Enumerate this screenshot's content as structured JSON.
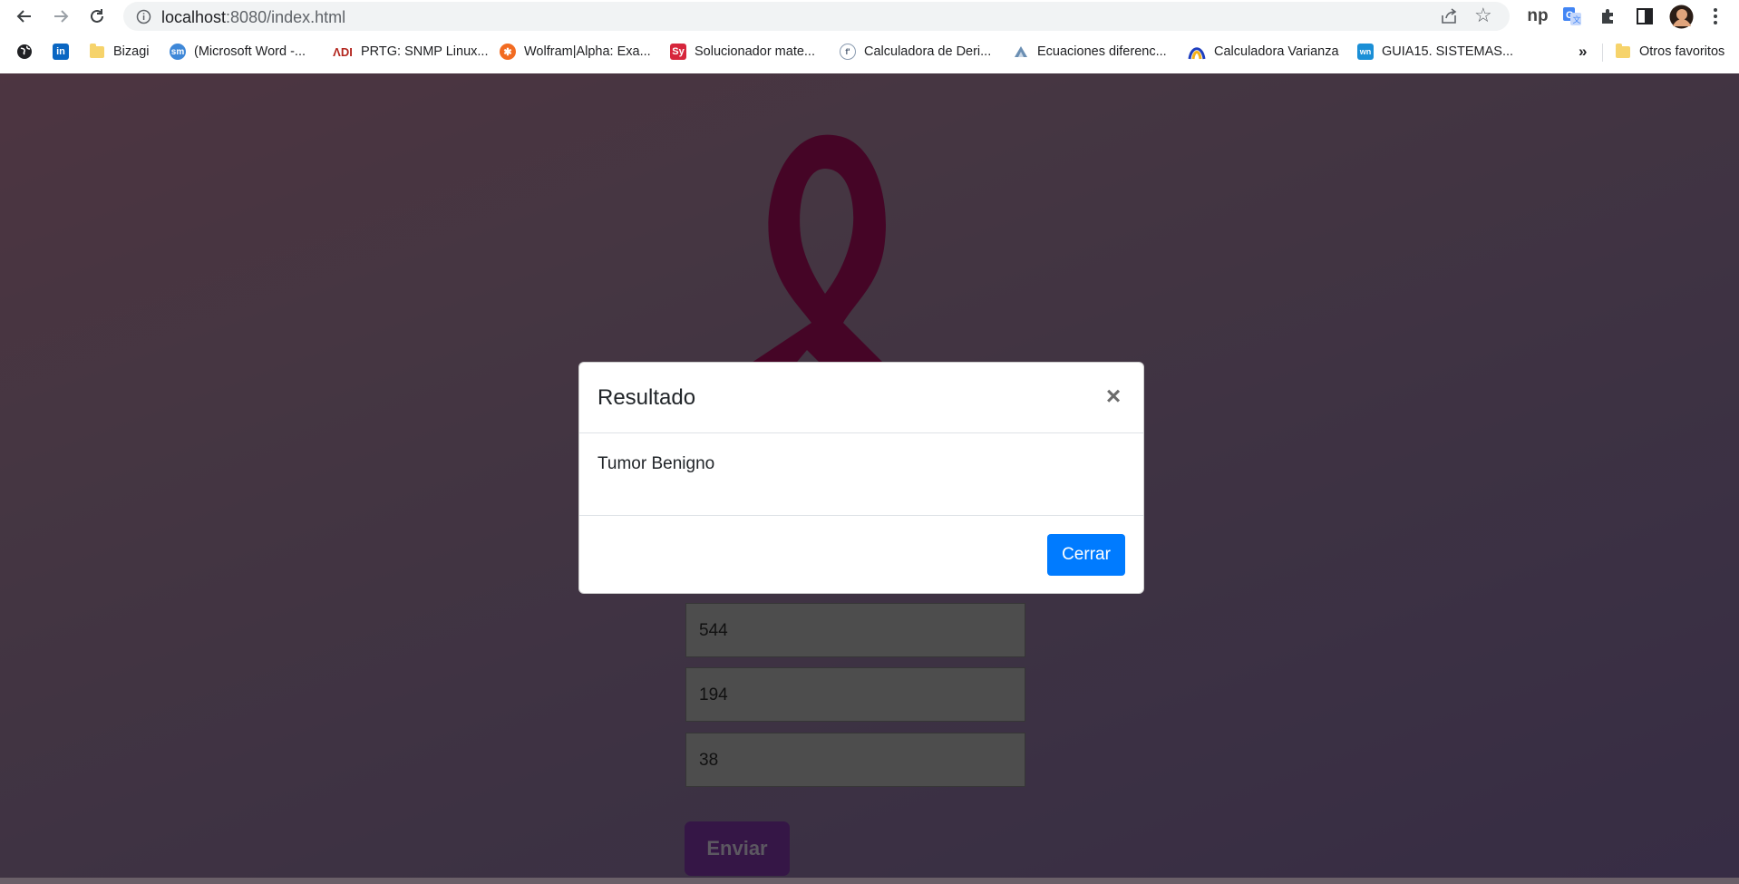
{
  "browser": {
    "url_host": "localhost",
    "url_rest": ":8080/index.html"
  },
  "bookmarks": [
    {
      "label": "Bizagi",
      "icon": "folder-icon"
    },
    {
      "label": "(Microsoft Word -...",
      "icon": "sm-icon"
    },
    {
      "label": "PRTG: SNMP Linux...",
      "icon": "prtg-icon"
    },
    {
      "label": "Wolfram|Alpha: Exa...",
      "icon": "wolfram-icon"
    },
    {
      "label": "Solucionador mate...",
      "icon": "sy-icon"
    },
    {
      "label": "Calculadora de Deri...",
      "icon": "derivative-icon"
    },
    {
      "label": "Ecuaciones diferenc...",
      "icon": "triangle-icon"
    },
    {
      "label": "Calculadora Varianza",
      "icon": "varianza-icon"
    },
    {
      "label": "GUIA15. SISTEMAS...",
      "icon": "wn-icon"
    }
  ],
  "overflow_label": "»",
  "other_bookmarks": "Otros favoritos",
  "form": {
    "fields": [
      "544",
      "194",
      "38"
    ],
    "submit_label": "Enviar"
  },
  "modal": {
    "title": "Resultado",
    "close_glyph": "×",
    "message": "Tumor Benigno",
    "close_button": "Cerrar"
  },
  "colors": {
    "ribbon": "#8a0a4c",
    "primary_button": "#007bff",
    "submit_button": "#6a2c8c"
  }
}
